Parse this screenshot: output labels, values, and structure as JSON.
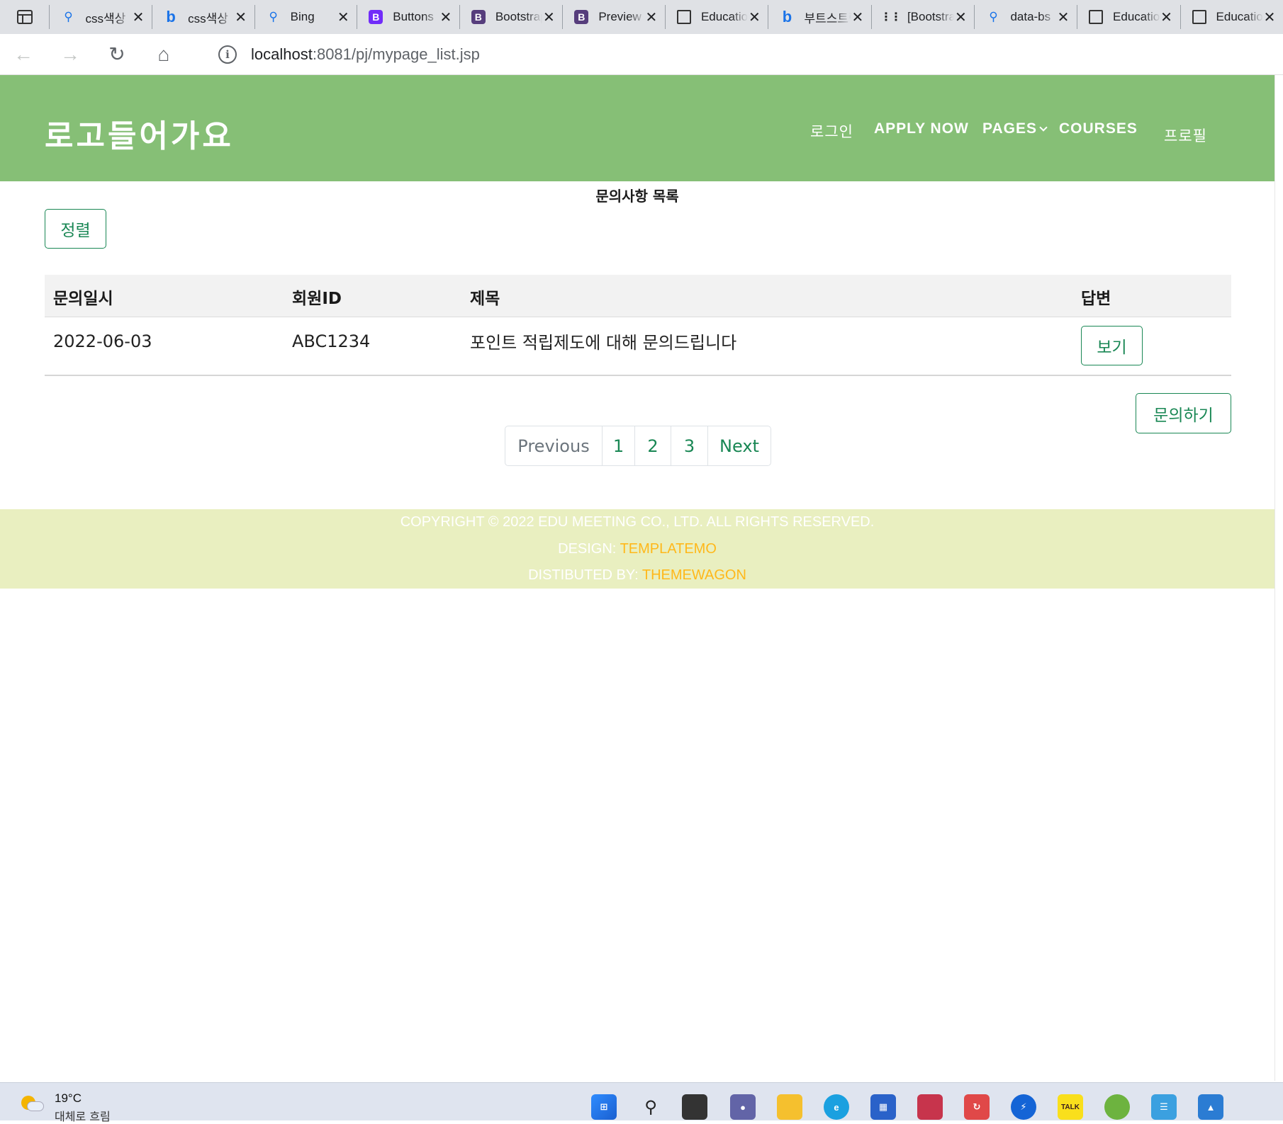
{
  "browser": {
    "tabs": [
      {
        "icon": "search-icon",
        "title": "css색상"
      },
      {
        "icon": "bing-icon",
        "title": "css색상"
      },
      {
        "icon": "search-icon",
        "title": "Bing"
      },
      {
        "icon": "bootstrap-icon",
        "title": "Buttons"
      },
      {
        "icon": "bootstrap-icon",
        "title": "Bootstrap"
      },
      {
        "icon": "bootstrap-icon",
        "title": "Preview"
      },
      {
        "icon": "page-icon",
        "title": "Education"
      },
      {
        "icon": "bing-icon",
        "title": "부트스트랩"
      },
      {
        "icon": "dots-icon",
        "title": "[Bootstrap"
      },
      {
        "icon": "search-icon",
        "title": "data-bs"
      },
      {
        "icon": "page-icon",
        "title": "Education"
      },
      {
        "icon": "page-icon",
        "title": "Education"
      }
    ],
    "url_host": "localhost",
    "url_path": ":8081/pj/mypage_list.jsp"
  },
  "header": {
    "logo": "로고들어가요",
    "nav": {
      "login": "로그인",
      "apply": "APPLY NOW",
      "pages": "PAGES",
      "courses": "COURSES",
      "profile": "프로필"
    }
  },
  "main": {
    "title": "문의사항 목록",
    "sort_button": "정렬",
    "table": {
      "columns": [
        "문의일시",
        "회원ID",
        "제목",
        "답변"
      ],
      "rows": [
        {
          "date": "2022-06-03",
          "member_id": "ABC1234",
          "subject": "포인트 적립제도에 대해 문의드립니다",
          "answer_button": "보기"
        }
      ]
    },
    "ask_button": "문의하기",
    "pagination": [
      "Previous",
      "1",
      "2",
      "3",
      "Next"
    ]
  },
  "footer": {
    "copyright": "COPYRIGHT © 2022 EDU MEETING CO., LTD. ALL RIGHTS RESERVED.",
    "design_label": "DESIGN: ",
    "design_link": "TEMPLATEMO",
    "dist_label": "DISTIBUTED BY: ",
    "dist_link": "THEMEWAGON"
  },
  "taskbar": {
    "temperature": "19°C",
    "weather": "대체로 흐림"
  },
  "colors": {
    "header_bg": "#86bf76",
    "footer_bg": "#e9efc0",
    "accent_green": "#198754",
    "footer_link": "#ffb81a"
  }
}
